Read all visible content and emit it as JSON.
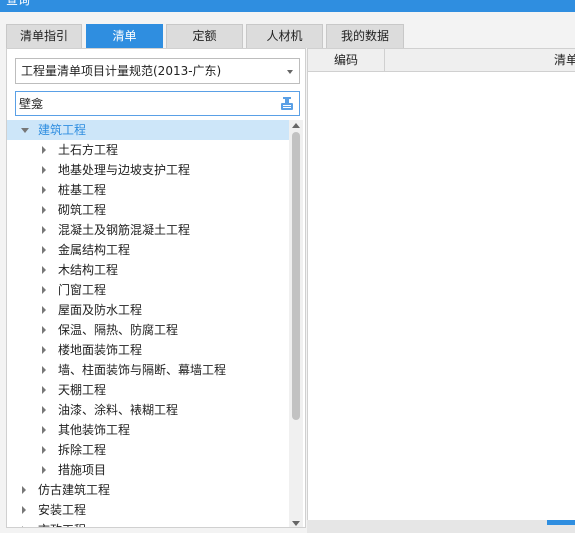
{
  "window": {
    "title": "查询"
  },
  "tabs": [
    {
      "label": "清单指引",
      "active": false
    },
    {
      "label": "清单",
      "active": true
    },
    {
      "label": "定额",
      "active": false
    },
    {
      "label": "人材机",
      "active": false
    },
    {
      "label": "我的数据",
      "active": false
    }
  ],
  "spec_select": {
    "value": "工程量清单项目计量规范(2013-广东)"
  },
  "search": {
    "value": "壁龛",
    "placeholder": ""
  },
  "tree": [
    {
      "label": "建筑工程",
      "level": 0,
      "expanded": true,
      "selected": true
    },
    {
      "label": "土石方工程",
      "level": 1
    },
    {
      "label": "地基处理与边坡支护工程",
      "level": 1
    },
    {
      "label": "桩基工程",
      "level": 1
    },
    {
      "label": "砌筑工程",
      "level": 1
    },
    {
      "label": "混凝土及钢筋混凝土工程",
      "level": 1
    },
    {
      "label": "金属结构工程",
      "level": 1
    },
    {
      "label": "木结构工程",
      "level": 1
    },
    {
      "label": "门窗工程",
      "level": 1
    },
    {
      "label": "屋面及防水工程",
      "level": 1
    },
    {
      "label": "保温、隔热、防腐工程",
      "level": 1
    },
    {
      "label": "楼地面装饰工程",
      "level": 1
    },
    {
      "label": "墙、柱面装饰与隔断、幕墙工程",
      "level": 1
    },
    {
      "label": "天棚工程",
      "level": 1
    },
    {
      "label": "油漆、涂料、裱糊工程",
      "level": 1
    },
    {
      "label": "其他装饰工程",
      "level": 1
    },
    {
      "label": "拆除工程",
      "level": 1
    },
    {
      "label": "措施项目",
      "level": 1
    },
    {
      "label": "仿古建筑工程",
      "level": 0
    },
    {
      "label": "安装工程",
      "level": 0
    },
    {
      "label": "市政工程",
      "level": 0
    }
  ],
  "table": {
    "columns": [
      "编码",
      "清单项"
    ]
  },
  "colors": {
    "accent": "#2f8ee0",
    "selected_bg": "#cde6f9"
  }
}
